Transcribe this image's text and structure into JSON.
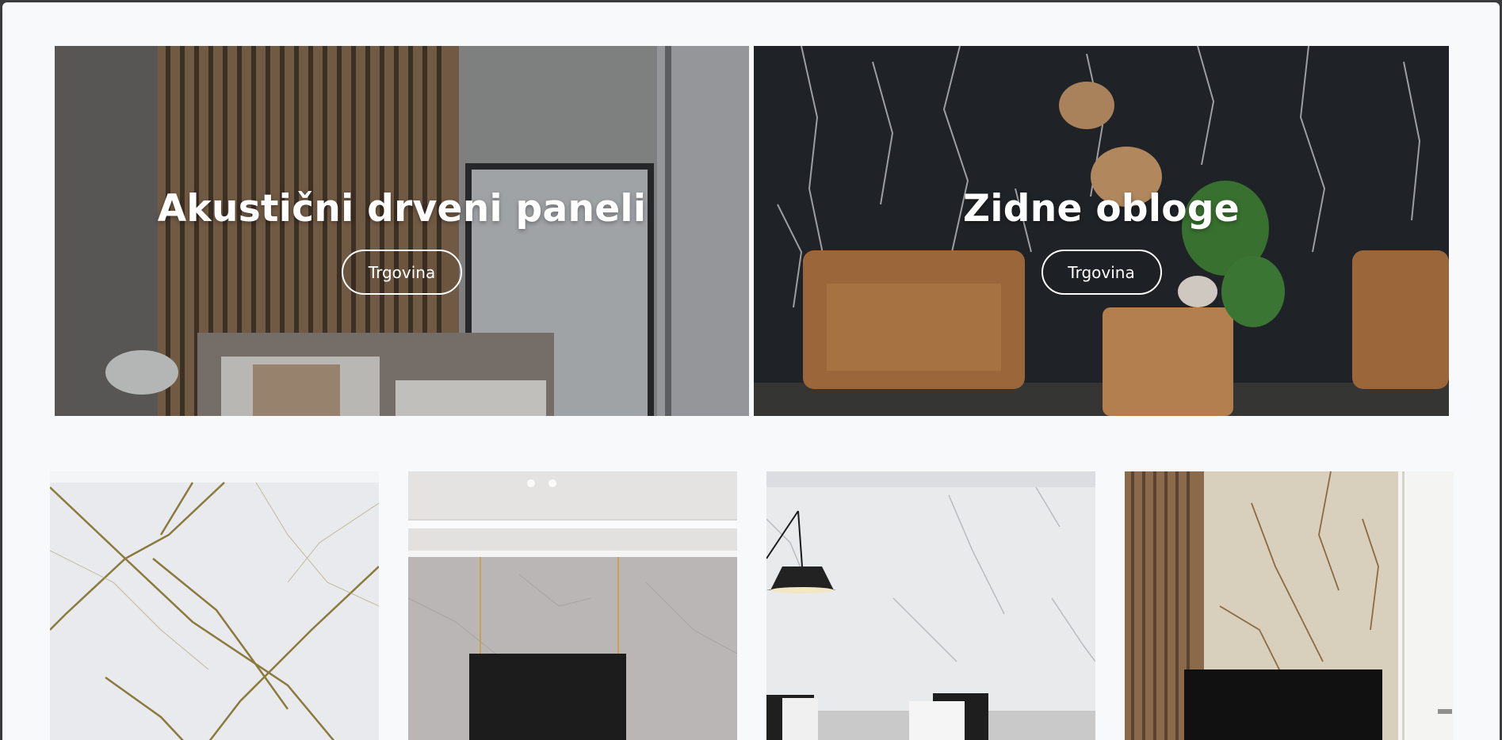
{
  "hero_banners": [
    {
      "title": "Akustični drveni paneli",
      "button_label": "Trgovina"
    },
    {
      "title": "Zidne obloge",
      "button_label": "Trgovina"
    }
  ],
  "category_tiles": [
    {
      "image": "white-marble-gold-veins"
    },
    {
      "image": "grey-marble-tv-wall"
    },
    {
      "image": "white-marble-living-room"
    },
    {
      "image": "beige-marble-wood-slats"
    }
  ],
  "colors": {
    "page_background": "#f7f9fb",
    "button_border": "#ffffff",
    "title_text": "#ffffff"
  }
}
